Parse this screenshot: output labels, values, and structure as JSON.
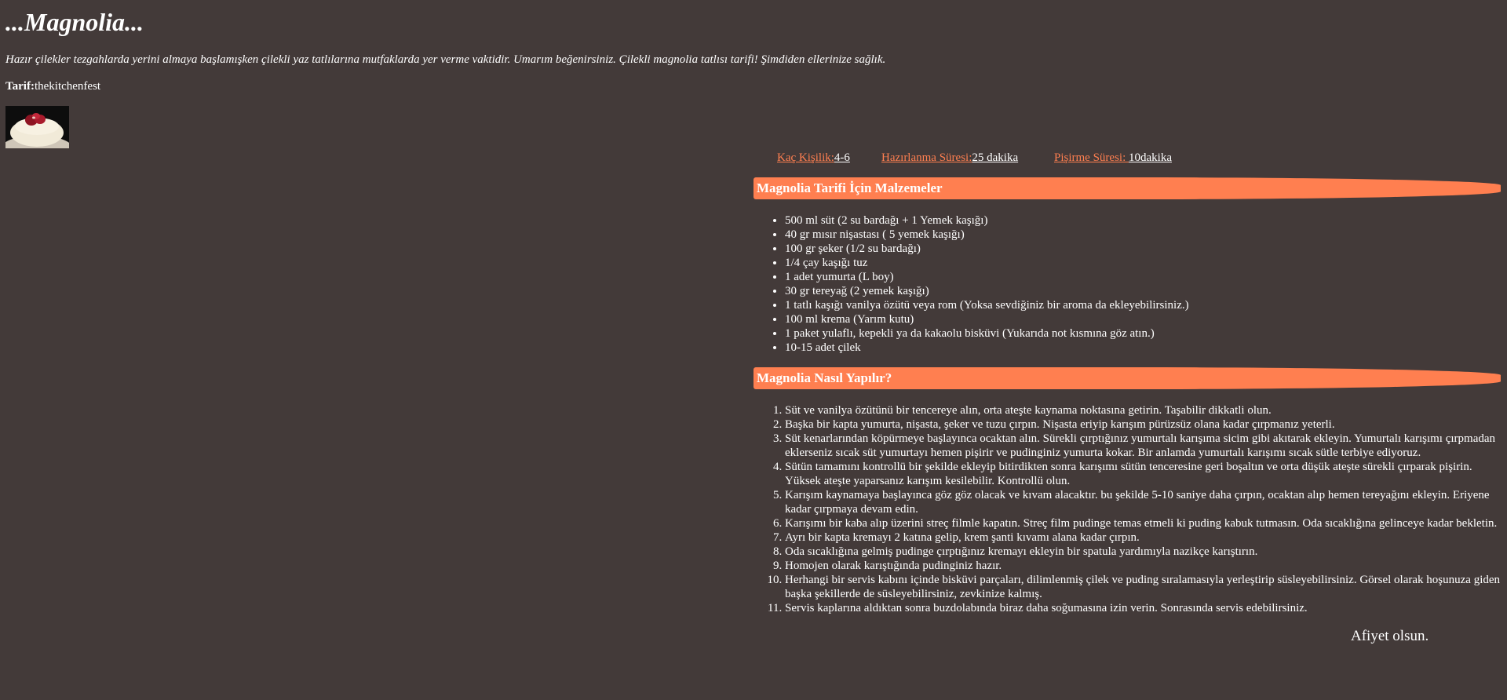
{
  "header": {
    "title": "...Magnolia...",
    "intro": "Hazır çilekler tezgahlarda yerini almaya başlamışken çilekli yaz tatlılarına mutfaklarda yer verme vaktidir. Umarım beğenirsiniz. Çilekli magnolia tatlısı tarifi! Şimdiden ellerinize sağlık.",
    "credit_label": "Tarif:",
    "credit_value": "thekitchenfest"
  },
  "meta": {
    "servings_label": "Kaç Kişilik:",
    "servings_value": "4-6",
    "prep_label": "Hazırlanma Süresi:",
    "prep_value": "25 dakika",
    "cook_label": "Pişirme Süresi: ",
    "cook_value": "10dakika"
  },
  "ingredients": {
    "heading": "Magnolia Tarifi İçin Malzemeler",
    "items": [
      "500 ml süt (2 su bardağı + 1 Yemek kaşığı)",
      "40 gr mısır nişastası ( 5 yemek kaşığı)",
      "100 gr şeker (1/2 su bardağı)",
      "1/4 çay kaşığı tuz",
      "1 adet yumurta (L boy)",
      "30 gr tereyağ (2 yemek kaşığı)",
      "1 tatlı kaşığı vanilya özütü veya rom (Yoksa sevdiğiniz bir aroma da ekleyebilirsiniz.)",
      "100 ml krema (Yarım kutu)",
      "1 paket yulaflı, kepekli ya da kakaolu bisküvi (Yukarıda not kısmına göz atın.)",
      "10-15 adet çilek"
    ]
  },
  "steps": {
    "heading": "Magnolia Nasıl Yapılır?",
    "items": [
      "Süt ve vanilya özütünü bir tencereye alın, orta ateşte kaynama noktasına getirin. Taşabilir dikkatli olun.",
      "Başka bir kapta yumurta, nişasta, şeker ve tuzu çırpın. Nişasta eriyip karışım pürüzsüz olana kadar çırpmanız yeterli.",
      "Süt kenarlarından köpürmeye başlayınca ocaktan alın. Sürekli çırptığınız yumurtalı karışıma sicim gibi akıtarak ekleyin. Yumurtalı karışımı çırpmadan eklerseniz sıcak süt yumurtayı hemen pişirir ve pudinginiz yumurta kokar. Bir anlamda yumurtalı karışımı sıcak sütle terbiye ediyoruz.",
      "Sütün tamamını kontrollü bir şekilde ekleyip bitirdikten sonra karışımı sütün tenceresine geri boşaltın ve orta düşük ateşte sürekli çırparak pişirin. Yüksek ateşte yaparsanız karışım kesilebilir. Kontrollü olun.",
      "Karışım kaynamaya başlayınca göz göz olacak ve kıvam alacaktır. bu şekilde 5-10 saniye daha çırpın, ocaktan alıp hemen tereyağını ekleyin. Eriyene kadar çırpmaya devam edin.",
      "Karışımı bir kaba alıp üzerini streç filmle kapatın. Streç film pudinge temas etmeli ki puding kabuk tutmasın. Oda sıcaklığına gelinceye kadar bekletin.",
      "Ayrı bir kapta kremayı 2 katına gelip, krem şanti kıvamı alana kadar çırpın.",
      "Oda sıcaklığına gelmiş pudinge çırptığınız kremayı ekleyin bir spatula yardımıyla nazikçe karıştırın.",
      "Homojen olarak karıştığında pudinginiz hazır.",
      "Herhangi bir servis kabını içinde bisküvi parçaları, dilimlenmiş çilek ve puding sıralamasıyla yerleştirip süsleyebilirsiniz. Görsel olarak hoşunuza giden başka şekillerde de süsleyebilirsiniz, zevkinize kalmış.",
      "Servis kaplarına aldıktan sonra buzdolabında biraz daha soğumasına izin verin. Sonrasında servis edebilirsiniz."
    ]
  },
  "footer": {
    "closing": "Afiyet olsun."
  },
  "colors": {
    "background": "#433a39",
    "accent": "#ff7f50",
    "text": "#ffffff"
  }
}
